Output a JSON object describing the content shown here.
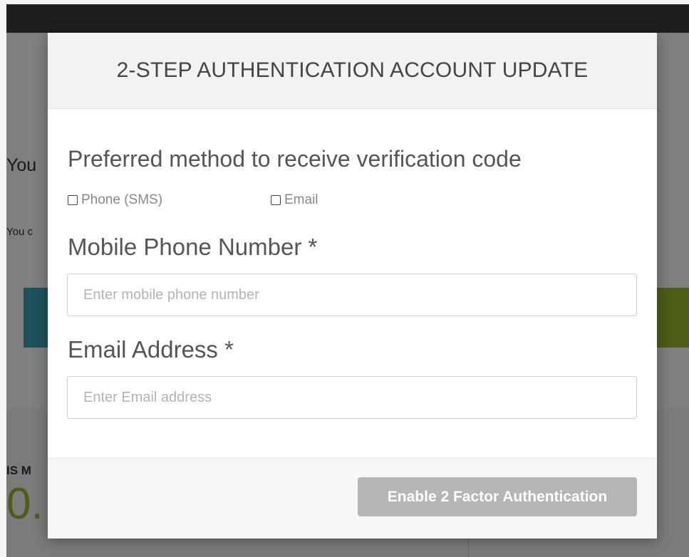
{
  "background": {
    "heading_fragment": "You",
    "subtext_fragment": "You c",
    "lower_label_fragment": "IS M",
    "big_number_fragment": "0."
  },
  "modal": {
    "title": "2-STEP AUTHENTICATION ACCOUNT UPDATE",
    "preferred_method_label": "Preferred method to receive verification code",
    "options": [
      {
        "label": "Phone (SMS)",
        "checked": false
      },
      {
        "label": "Email",
        "checked": false
      }
    ],
    "phone_field": {
      "label": "Mobile Phone Number *",
      "placeholder": "Enter mobile phone number",
      "value": ""
    },
    "email_field": {
      "label": "Email Address *",
      "placeholder": "Enter Email address",
      "value": ""
    },
    "submit_label": "Enable 2 Factor Authentication"
  },
  "colors": {
    "topbar": "#1e1e1e",
    "teal_button": "#3aa6b7",
    "green_button": "#9bbb2d",
    "disabled_button": "#b5b5b5"
  }
}
